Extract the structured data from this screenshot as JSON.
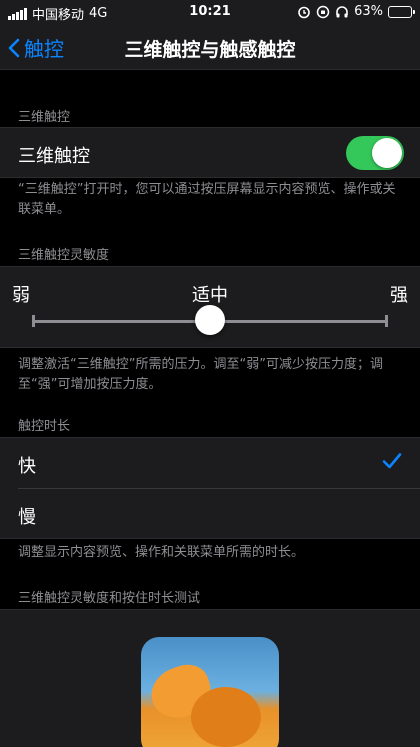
{
  "status_bar": {
    "carrier": "中国移动",
    "network": "4G",
    "time": "10:21",
    "battery": "63%",
    "battery_level": 0.63
  },
  "nav": {
    "back_label": "触控",
    "title": "三维触控与触感触控"
  },
  "section_3d": {
    "header": "三维触控",
    "toggle_label": "三维触控",
    "toggle_on": true,
    "footer": "“三维触控”打开时，您可以通过按压屏幕显示内容预览、操作或关联菜单。"
  },
  "section_sensitivity": {
    "header": "三维触控灵敏度",
    "label_low": "弱",
    "label_mid": "适中",
    "label_high": "强",
    "level": 0.5,
    "footer": "调整激活“三维触控”所需的压力。调至“弱”可减少按压力度；调至“强”可增加按压力度。"
  },
  "section_duration": {
    "header": "触控时长",
    "options": [
      {
        "label": "快",
        "selected": true
      },
      {
        "label": "慢",
        "selected": false
      }
    ],
    "footer": "调整显示内容预览、操作和关联菜单所需的时长。"
  },
  "section_test": {
    "header": "三维触控灵敏度和按住时长测试"
  },
  "colors": {
    "accent": "#0a84ff",
    "toggle_on": "#34c759",
    "background": "#000000",
    "cell": "#1c1c1e",
    "secondary_text": "#8e8e93"
  }
}
